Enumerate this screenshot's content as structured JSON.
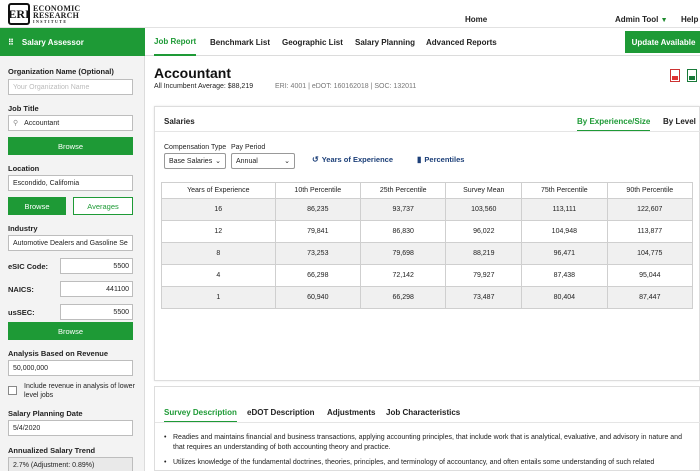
{
  "header": {
    "logo_mark": "ERI",
    "logo_line1": "ECONOMIC",
    "logo_line2": "RESEARCH",
    "logo_line3": "INSTITUTE",
    "nav": [
      "Home",
      "Admin Tool",
      "Help"
    ]
  },
  "navbar": {
    "app_name": "Salary Assessor",
    "tabs": [
      "Job Report",
      "Benchmark List",
      "Geographic List",
      "Salary Planning",
      "Advanced Reports"
    ],
    "active_tab": "Job Report",
    "update_label": "Update Available"
  },
  "sidebar": {
    "org_label": "Organization Name (Optional)",
    "org_placeholder": "Your Organization Name",
    "job_label": "Job Title",
    "job_value": "Accountant",
    "browse1": "Browse",
    "location_label": "Location",
    "location_value": "Escondido, California",
    "browse2": "Browse",
    "averages": "Averages",
    "industry_label": "Industry",
    "industry_value": "Automotive Dealers and Gasoline Se",
    "esic_label": "eSIC Code:",
    "esic_value": "5500",
    "naics_label": "NAICS:",
    "naics_value": "441100",
    "ussec_label": "usSEC:",
    "ussec_value": "5500",
    "browse3": "Browse",
    "revenue_label": "Analysis Based on Revenue",
    "revenue_value": "50,000,000",
    "checkbox_text": "Include revenue in analysis of lower level jobs",
    "date_label": "Salary Planning Date",
    "date_value": "5/4/2020",
    "trend_label": "Annualized Salary Trend",
    "trend_value": "2.7% (Adjustment: 0.89%)"
  },
  "main": {
    "title": "Accountant",
    "incumbent": "All Incumbent Average: $88,219",
    "codes": "ERI: 4001 | eDOT: 160162018 | SOC: 132011",
    "salaries": {
      "title": "Salaries",
      "tabs": [
        "By Experience/Size",
        "By Level"
      ],
      "comp_label": "Compensation Type",
      "comp_value": "Base Salaries",
      "period_label": "Pay Period",
      "period_value": "Annual",
      "years_link": "Years of Experience",
      "percentiles_link": "Percentiles",
      "table": {
        "headers": [
          "Years of Experience",
          "10th Percentile",
          "25th Percentile",
          "Survey Mean",
          "75th Percentile",
          "90th Percentile"
        ],
        "rows": [
          [
            "16",
            "86,235",
            "93,737",
            "103,560",
            "113,111",
            "122,607"
          ],
          [
            "12",
            "79,841",
            "86,830",
            "96,022",
            "104,948",
            "113,877"
          ],
          [
            "8",
            "73,253",
            "79,698",
            "88,219",
            "96,471",
            "104,775"
          ],
          [
            "4",
            "66,298",
            "72,142",
            "79,927",
            "87,438",
            "95,044"
          ],
          [
            "1",
            "60,940",
            "66,298",
            "73,487",
            "80,404",
            "87,447"
          ]
        ]
      }
    },
    "description": {
      "tabs": [
        "Survey Description",
        "eDOT Description",
        "Adjustments",
        "Job Characteristics"
      ],
      "bullets": [
        "Readies and maintains financial and business transactions, applying accounting principles, that include work that is analytical, evaluative, and advisory in nature and that requires an understanding of both accounting theory and practice.",
        "Utilizes knowledge of the fundamental doctrines, theories, principles, and terminology of accountancy, and often entails some understanding of such related"
      ]
    }
  }
}
